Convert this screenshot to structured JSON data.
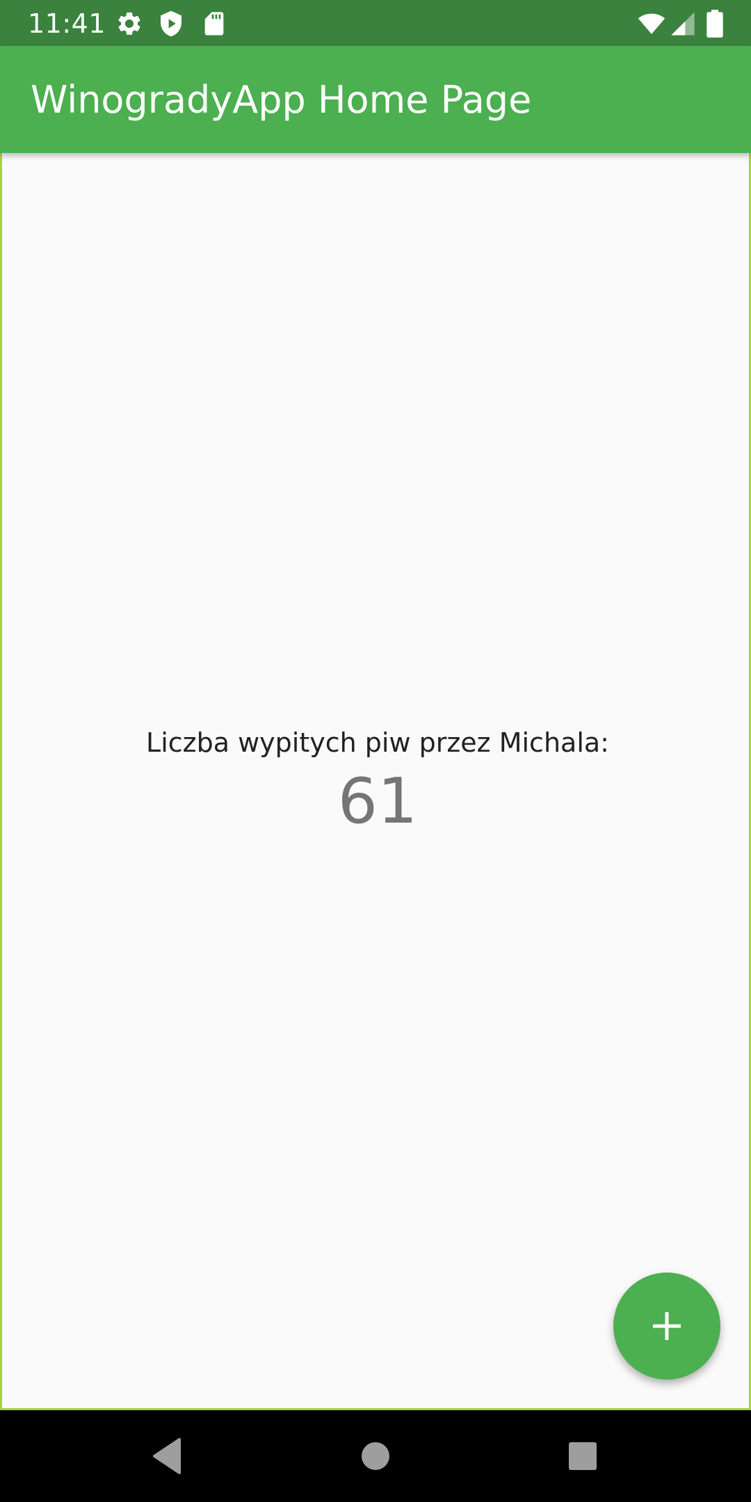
{
  "status_bar": {
    "time": "11:41",
    "icons_left": [
      "settings-icon",
      "shield-play-icon",
      "sd-card-icon"
    ],
    "icons_right": [
      "wifi-icon",
      "cell-signal-icon",
      "battery-icon"
    ],
    "background": "#3a823e"
  },
  "app_bar": {
    "title": "WinogradyApp Home Page",
    "background": "#4caf50"
  },
  "main": {
    "label": "Liczba wypitych piw przez Michala:",
    "count": "61"
  },
  "fab": {
    "icon": "plus-icon",
    "color": "#4caf50"
  },
  "nav_bar": {
    "buttons": [
      "back-icon",
      "home-icon",
      "recents-icon"
    ]
  }
}
